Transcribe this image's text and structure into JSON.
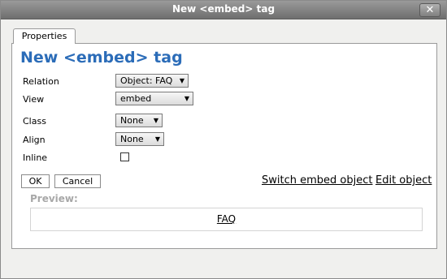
{
  "window": {
    "title": "New <embed> tag",
    "close_label": "✕"
  },
  "tabs": [
    {
      "label": "Properties"
    }
  ],
  "form": {
    "heading": "New <embed> tag",
    "fields": {
      "relation": {
        "label": "Relation",
        "value": "Object: FAQ"
      },
      "view": {
        "label": "View",
        "value": "embed"
      },
      "class": {
        "label": "Class",
        "value": "None"
      },
      "align": {
        "label": "Align",
        "value": "None"
      },
      "inline": {
        "label": "Inline",
        "checked": false
      }
    }
  },
  "actions": {
    "ok_label": "OK",
    "cancel_label": "Cancel",
    "switch_label": "Switch embed object",
    "edit_label": "Edit object"
  },
  "preview": {
    "label": "Preview:",
    "link_text": "FAQ"
  },
  "colors": {
    "heading": "#2b6cb8",
    "titlebar": "#7a7a7a",
    "preview_label": "#a8a8a8"
  }
}
